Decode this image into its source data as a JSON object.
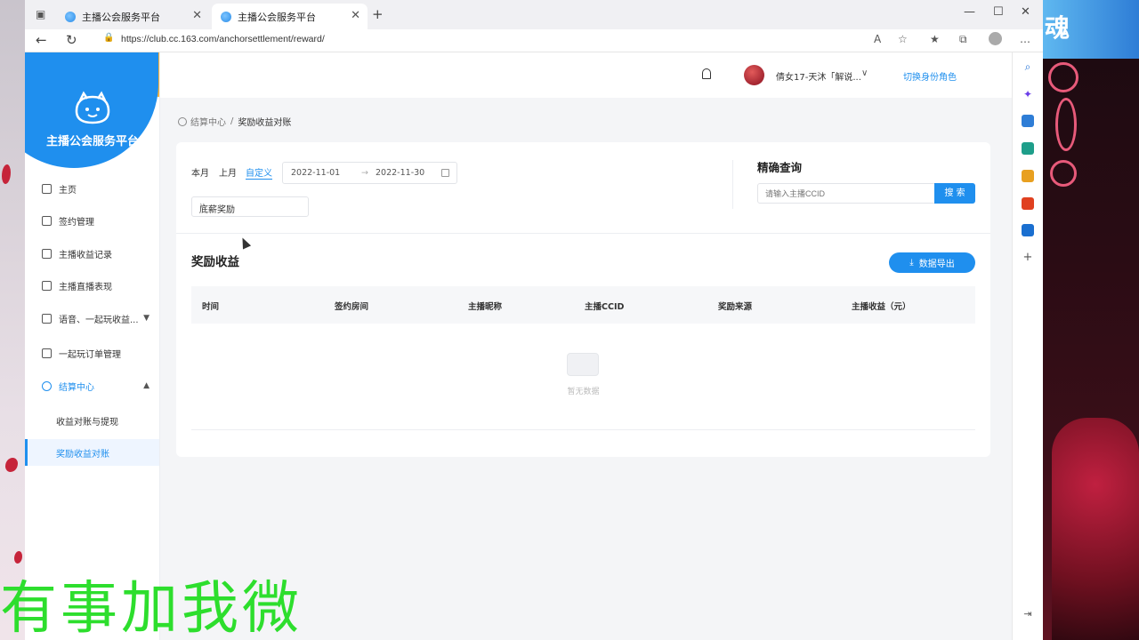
{
  "browser": {
    "tabs": [
      {
        "title": "主播公会服务平台"
      },
      {
        "title": "主播公会服务平台"
      }
    ],
    "url": "https://club.cc.163.com/anchorsettlement/reward/"
  },
  "app": {
    "logo_title": "主播公会服务平台",
    "nav": [
      {
        "label": "主页"
      },
      {
        "label": "签约管理"
      },
      {
        "label": "主播收益记录"
      },
      {
        "label": "主播直播表现"
      },
      {
        "label": "语音、一起玩收益..."
      },
      {
        "label": "一起玩订单管理"
      },
      {
        "label": "结算中心"
      }
    ],
    "subnav": [
      {
        "label": "收益对账与提现"
      },
      {
        "label": "奖励收益对账"
      }
    ],
    "header": {
      "username": "倩女17-天沐「解说...",
      "switch_role": "切换身份角色"
    },
    "breadcrumb": {
      "root": "结算中心",
      "sep": "/",
      "current": "奖励收益对账"
    },
    "filters": {
      "periods": [
        "本月",
        "上月",
        "自定义"
      ],
      "date_start": "2022-11-01",
      "date_sep": "→",
      "date_end": "2022-11-30",
      "reward_type": "底薪奖励"
    },
    "precise": {
      "title": "精确查询",
      "placeholder": "请输入主播CCID",
      "search_label": "搜 索"
    },
    "results": {
      "title": "奖励收益",
      "export_label": "数据导出",
      "columns": [
        "时间",
        "签约房间",
        "主播昵称",
        "主播CCID",
        "奖励来源",
        "主播收益（元）"
      ],
      "empty_text": "暂无数据"
    }
  },
  "desktop": {
    "right_title": "魂",
    "overlay_text": "有事加我微"
  }
}
